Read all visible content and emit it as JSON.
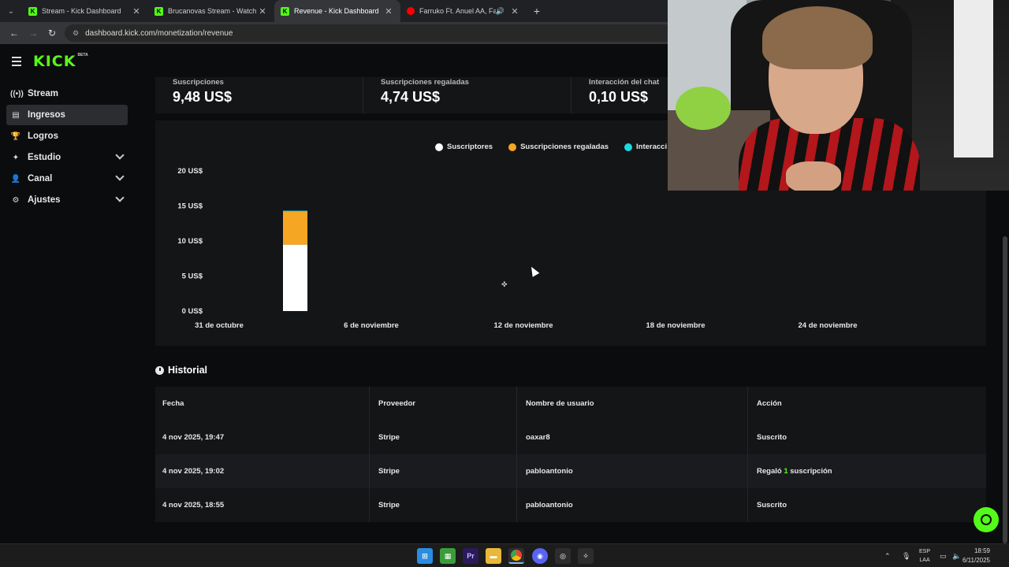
{
  "browser": {
    "tabs": [
      {
        "title": "Stream - Kick Dashboard",
        "icon": "kick-favicon",
        "active": false
      },
      {
        "title": "Brucanovas Stream - Watch Live",
        "icon": "kick-favicon",
        "active": false
      },
      {
        "title": "Revenue - Kick Dashboard",
        "icon": "kick-favicon",
        "active": true
      },
      {
        "title": "Farruko Ft. Anuel AA, Fat Jo",
        "icon": "youtube-favicon",
        "active": false
      }
    ],
    "url": "dashboard.kick.com/monetization/revenue"
  },
  "header": {
    "logo": "KICK",
    "logo_badge": "BETA"
  },
  "sidebar": {
    "items": [
      {
        "label": "Stream",
        "icon": "broadcast-icon",
        "active": false,
        "expandable": false
      },
      {
        "label": "Ingresos",
        "icon": "ledger-icon",
        "active": true,
        "expandable": false
      },
      {
        "label": "Logros",
        "icon": "trophy-icon",
        "active": false,
        "expandable": false
      },
      {
        "label": "Estudio",
        "icon": "studio-icon",
        "active": false,
        "expandable": true
      },
      {
        "label": "Canal",
        "icon": "channel-icon",
        "active": false,
        "expandable": true
      },
      {
        "label": "Ajustes",
        "icon": "gear-icon",
        "active": false,
        "expandable": true
      }
    ]
  },
  "stats": [
    {
      "label": "Suscripciones",
      "value": "9,48 US$"
    },
    {
      "label": "Suscripciones regaladas",
      "value": "4,74 US$"
    },
    {
      "label": "Interacción del chat",
      "value": "0,10 US$"
    }
  ],
  "chart_data": {
    "type": "bar",
    "stacked": true,
    "x_labels": [
      "31 de octubre",
      "6 de noviembre",
      "12 de noviembre",
      "18 de noviembre",
      "24 de noviembre"
    ],
    "y_ticks": [
      "0 US$",
      "5 US$",
      "10 US$",
      "15 US$",
      "20 US$"
    ],
    "ylim": [
      0,
      20
    ],
    "series": [
      {
        "name": "Suscriptores",
        "color": "#ffffff",
        "values": [
          9.48
        ]
      },
      {
        "name": "Suscripciones regaladas",
        "color": "#f5a623",
        "values": [
          4.74
        ]
      },
      {
        "name": "Interacci",
        "color": "#1fd8e0",
        "values": [
          0.1
        ]
      }
    ],
    "bar_dates": [
      "4 nov 2025"
    ],
    "legend": "top-center",
    "grid": false
  },
  "historial": {
    "title": "Historial",
    "columns": [
      "Fecha",
      "Proveedor",
      "Nombre de usuario",
      "Acción"
    ],
    "rows": [
      {
        "fecha": "4 nov 2025, 19:47",
        "proveedor": "Stripe",
        "usuario": "oaxar8",
        "accion_pre": "Suscrito",
        "accion_num": "",
        "accion_post": ""
      },
      {
        "fecha": "4 nov 2025, 19:02",
        "proveedor": "Stripe",
        "usuario": "pabloantonio",
        "accion_pre": "Regaló ",
        "accion_num": "1",
        "accion_post": " suscripción"
      },
      {
        "fecha": "4 nov 2025, 18:55",
        "proveedor": "Stripe",
        "usuario": "pabloantonio",
        "accion_pre": "Suscrito",
        "accion_num": "",
        "accion_post": ""
      }
    ]
  },
  "taskbar": {
    "lang_top": "ESP",
    "lang_bottom": "LAA",
    "time": "18:59",
    "date": "6/11/2025"
  },
  "colors": {
    "accent": "#53fc18",
    "gifted": "#f5a623",
    "chat": "#1fd8e0"
  }
}
